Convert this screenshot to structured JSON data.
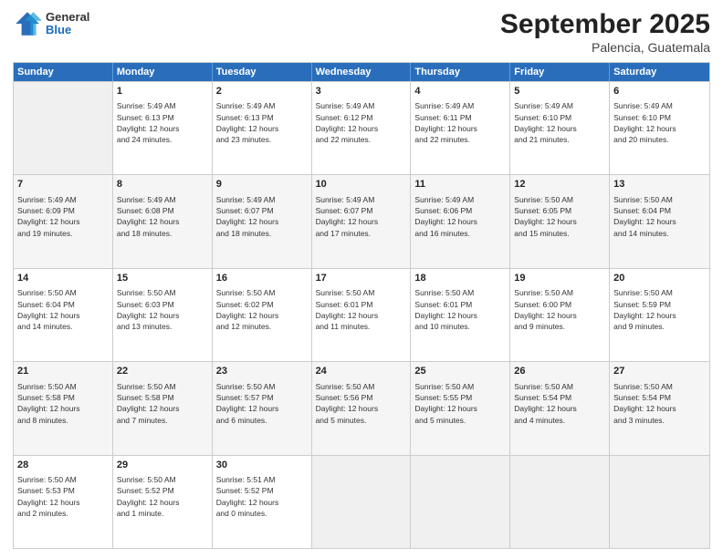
{
  "header": {
    "logo": {
      "general": "General",
      "blue": "Blue"
    },
    "title": "September 2025",
    "location": "Palencia, Guatemala"
  },
  "days_of_week": [
    "Sunday",
    "Monday",
    "Tuesday",
    "Wednesday",
    "Thursday",
    "Friday",
    "Saturday"
  ],
  "weeks": [
    [
      {
        "date": "",
        "info": ""
      },
      {
        "date": "1",
        "info": "Sunrise: 5:49 AM\nSunset: 6:13 PM\nDaylight: 12 hours\nand 24 minutes."
      },
      {
        "date": "2",
        "info": "Sunrise: 5:49 AM\nSunset: 6:13 PM\nDaylight: 12 hours\nand 23 minutes."
      },
      {
        "date": "3",
        "info": "Sunrise: 5:49 AM\nSunset: 6:12 PM\nDaylight: 12 hours\nand 22 minutes."
      },
      {
        "date": "4",
        "info": "Sunrise: 5:49 AM\nSunset: 6:11 PM\nDaylight: 12 hours\nand 22 minutes."
      },
      {
        "date": "5",
        "info": "Sunrise: 5:49 AM\nSunset: 6:10 PM\nDaylight: 12 hours\nand 21 minutes."
      },
      {
        "date": "6",
        "info": "Sunrise: 5:49 AM\nSunset: 6:10 PM\nDaylight: 12 hours\nand 20 minutes."
      }
    ],
    [
      {
        "date": "7",
        "info": "Sunrise: 5:49 AM\nSunset: 6:09 PM\nDaylight: 12 hours\nand 19 minutes."
      },
      {
        "date": "8",
        "info": "Sunrise: 5:49 AM\nSunset: 6:08 PM\nDaylight: 12 hours\nand 18 minutes."
      },
      {
        "date": "9",
        "info": "Sunrise: 5:49 AM\nSunset: 6:07 PM\nDaylight: 12 hours\nand 18 minutes."
      },
      {
        "date": "10",
        "info": "Sunrise: 5:49 AM\nSunset: 6:07 PM\nDaylight: 12 hours\nand 17 minutes."
      },
      {
        "date": "11",
        "info": "Sunrise: 5:49 AM\nSunset: 6:06 PM\nDaylight: 12 hours\nand 16 minutes."
      },
      {
        "date": "12",
        "info": "Sunrise: 5:50 AM\nSunset: 6:05 PM\nDaylight: 12 hours\nand 15 minutes."
      },
      {
        "date": "13",
        "info": "Sunrise: 5:50 AM\nSunset: 6:04 PM\nDaylight: 12 hours\nand 14 minutes."
      }
    ],
    [
      {
        "date": "14",
        "info": "Sunrise: 5:50 AM\nSunset: 6:04 PM\nDaylight: 12 hours\nand 14 minutes."
      },
      {
        "date": "15",
        "info": "Sunrise: 5:50 AM\nSunset: 6:03 PM\nDaylight: 12 hours\nand 13 minutes."
      },
      {
        "date": "16",
        "info": "Sunrise: 5:50 AM\nSunset: 6:02 PM\nDaylight: 12 hours\nand 12 minutes."
      },
      {
        "date": "17",
        "info": "Sunrise: 5:50 AM\nSunset: 6:01 PM\nDaylight: 12 hours\nand 11 minutes."
      },
      {
        "date": "18",
        "info": "Sunrise: 5:50 AM\nSunset: 6:01 PM\nDaylight: 12 hours\nand 10 minutes."
      },
      {
        "date": "19",
        "info": "Sunrise: 5:50 AM\nSunset: 6:00 PM\nDaylight: 12 hours\nand 9 minutes."
      },
      {
        "date": "20",
        "info": "Sunrise: 5:50 AM\nSunset: 5:59 PM\nDaylight: 12 hours\nand 9 minutes."
      }
    ],
    [
      {
        "date": "21",
        "info": "Sunrise: 5:50 AM\nSunset: 5:58 PM\nDaylight: 12 hours\nand 8 minutes."
      },
      {
        "date": "22",
        "info": "Sunrise: 5:50 AM\nSunset: 5:58 PM\nDaylight: 12 hours\nand 7 minutes."
      },
      {
        "date": "23",
        "info": "Sunrise: 5:50 AM\nSunset: 5:57 PM\nDaylight: 12 hours\nand 6 minutes."
      },
      {
        "date": "24",
        "info": "Sunrise: 5:50 AM\nSunset: 5:56 PM\nDaylight: 12 hours\nand 5 minutes."
      },
      {
        "date": "25",
        "info": "Sunrise: 5:50 AM\nSunset: 5:55 PM\nDaylight: 12 hours\nand 5 minutes."
      },
      {
        "date": "26",
        "info": "Sunrise: 5:50 AM\nSunset: 5:54 PM\nDaylight: 12 hours\nand 4 minutes."
      },
      {
        "date": "27",
        "info": "Sunrise: 5:50 AM\nSunset: 5:54 PM\nDaylight: 12 hours\nand 3 minutes."
      }
    ],
    [
      {
        "date": "28",
        "info": "Sunrise: 5:50 AM\nSunset: 5:53 PM\nDaylight: 12 hours\nand 2 minutes."
      },
      {
        "date": "29",
        "info": "Sunrise: 5:50 AM\nSunset: 5:52 PM\nDaylight: 12 hours\nand 1 minute."
      },
      {
        "date": "30",
        "info": "Sunrise: 5:51 AM\nSunset: 5:52 PM\nDaylight: 12 hours\nand 0 minutes."
      },
      {
        "date": "",
        "info": ""
      },
      {
        "date": "",
        "info": ""
      },
      {
        "date": "",
        "info": ""
      },
      {
        "date": "",
        "info": ""
      }
    ]
  ]
}
